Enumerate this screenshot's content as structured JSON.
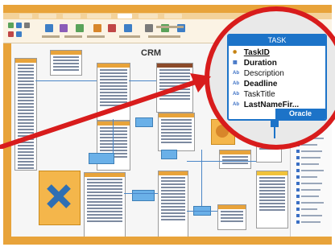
{
  "diagram": {
    "title": "CRM"
  },
  "zoom_table": {
    "name": "TASK",
    "fields": [
      {
        "label": "TaskID",
        "kind": "primary-key",
        "bold": true,
        "underline": true
      },
      {
        "label": "Duration",
        "kind": "number",
        "bold": true,
        "underline": false
      },
      {
        "label": "Description",
        "kind": "text",
        "bold": false,
        "underline": false
      },
      {
        "label": "Deadline",
        "kind": "date",
        "bold": true,
        "underline": false
      },
      {
        "label": "TaskTitle",
        "kind": "text",
        "bold": false,
        "underline": false
      },
      {
        "label": "LastNameFir...",
        "kind": "text",
        "bold": true,
        "underline": false
      }
    ],
    "database_badge": "Oracle"
  },
  "colors": {
    "accent": "#e8a33a",
    "zoom_ring": "#d81c1c",
    "table_header": "#1c73c8",
    "arrow": "#d81c1c"
  },
  "icons": [
    "primary-key-icon",
    "number-field-icon",
    "text-field-icon",
    "date-field-icon"
  ]
}
